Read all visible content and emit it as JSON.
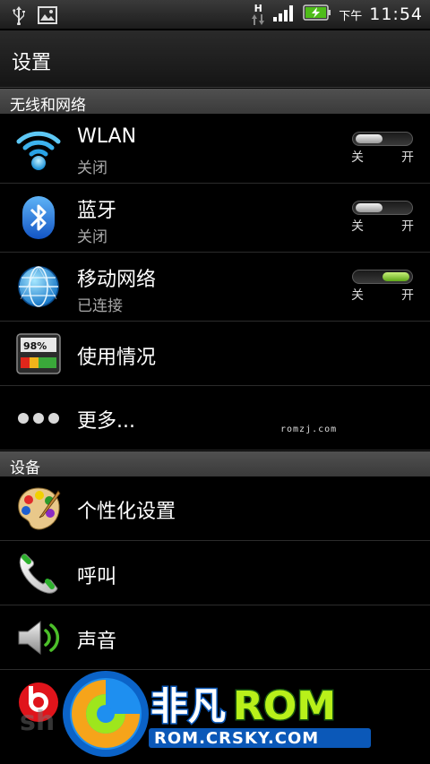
{
  "statusbar": {
    "icons": [
      "usb-icon",
      "image-icon",
      "network-h-icon",
      "signal-icon",
      "battery-charging-icon"
    ],
    "network_type": "H",
    "ampm": "下午",
    "time": "11:54"
  },
  "title": "设置",
  "sections": {
    "wireless": "无线和网络",
    "device": "设备"
  },
  "rows": {
    "wlan": {
      "title": "WLAN",
      "subtitle": "关闭",
      "icon": "wifi-icon",
      "state": "off"
    },
    "bluetooth": {
      "title": "蓝牙",
      "subtitle": "关闭",
      "icon": "bluetooth-icon",
      "state": "off"
    },
    "mobile": {
      "title": "移动网络",
      "subtitle": "已连接",
      "icon": "globe-network-icon",
      "state": "on"
    },
    "usage": {
      "title": "使用情况",
      "icon": "usage-meter-icon",
      "meter_text": "98%"
    },
    "more": {
      "title": "更多...",
      "icon": "more-dots-icon"
    },
    "personalize": {
      "title": "个性化设置",
      "icon": "paint-palette-icon"
    },
    "call": {
      "title": "呼叫",
      "icon": "phone-icon"
    },
    "sound": {
      "title": "声音",
      "icon": "speaker-icon"
    },
    "beats": {
      "icon": "beats-audio-icon"
    }
  },
  "toggle_labels": {
    "off": "关",
    "on": "开"
  },
  "watermark": {
    "small": "romzj.com",
    "brand_cn": "非凡",
    "brand_rom": "ROM",
    "url": "ROM.CRSKY.COM",
    "faint": "sh"
  },
  "colors": {
    "accent_on": "#7cc623",
    "section_bg": "#444444",
    "subtitle": "#a8a8a8"
  }
}
